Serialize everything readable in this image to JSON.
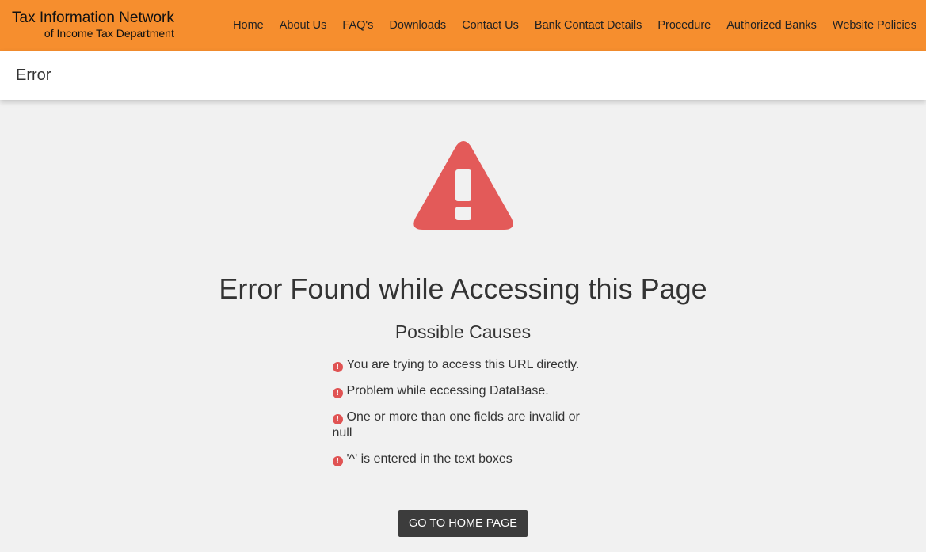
{
  "brand": {
    "line1": "Tax Information Network",
    "line2": "of Income Tax Department"
  },
  "nav": [
    "Home",
    "About Us",
    "FAQ's",
    "Downloads",
    "Contact Us",
    "Bank Contact Details",
    "Procedure",
    "Authorized Banks",
    "Website Policies"
  ],
  "page_title": "Error",
  "error": {
    "heading": "Error Found while Accessing this Page",
    "causes_heading": "Possible Causes",
    "causes": [
      "You are trying to access this URL directly.",
      "Problem while eccessing DataBase.",
      "One or more than one fields are invalid or null",
      "'^' is entered in the text boxes"
    ],
    "button": "GO TO HOME PAGE"
  },
  "colors": {
    "header": "#f68e2e",
    "warning": "#e35a59",
    "button": "#3c3c3c",
    "background": "#f1f1f1"
  },
  "icons": {
    "warning": "warning-triangle-icon",
    "cause": "exclamation-circle-icon"
  }
}
